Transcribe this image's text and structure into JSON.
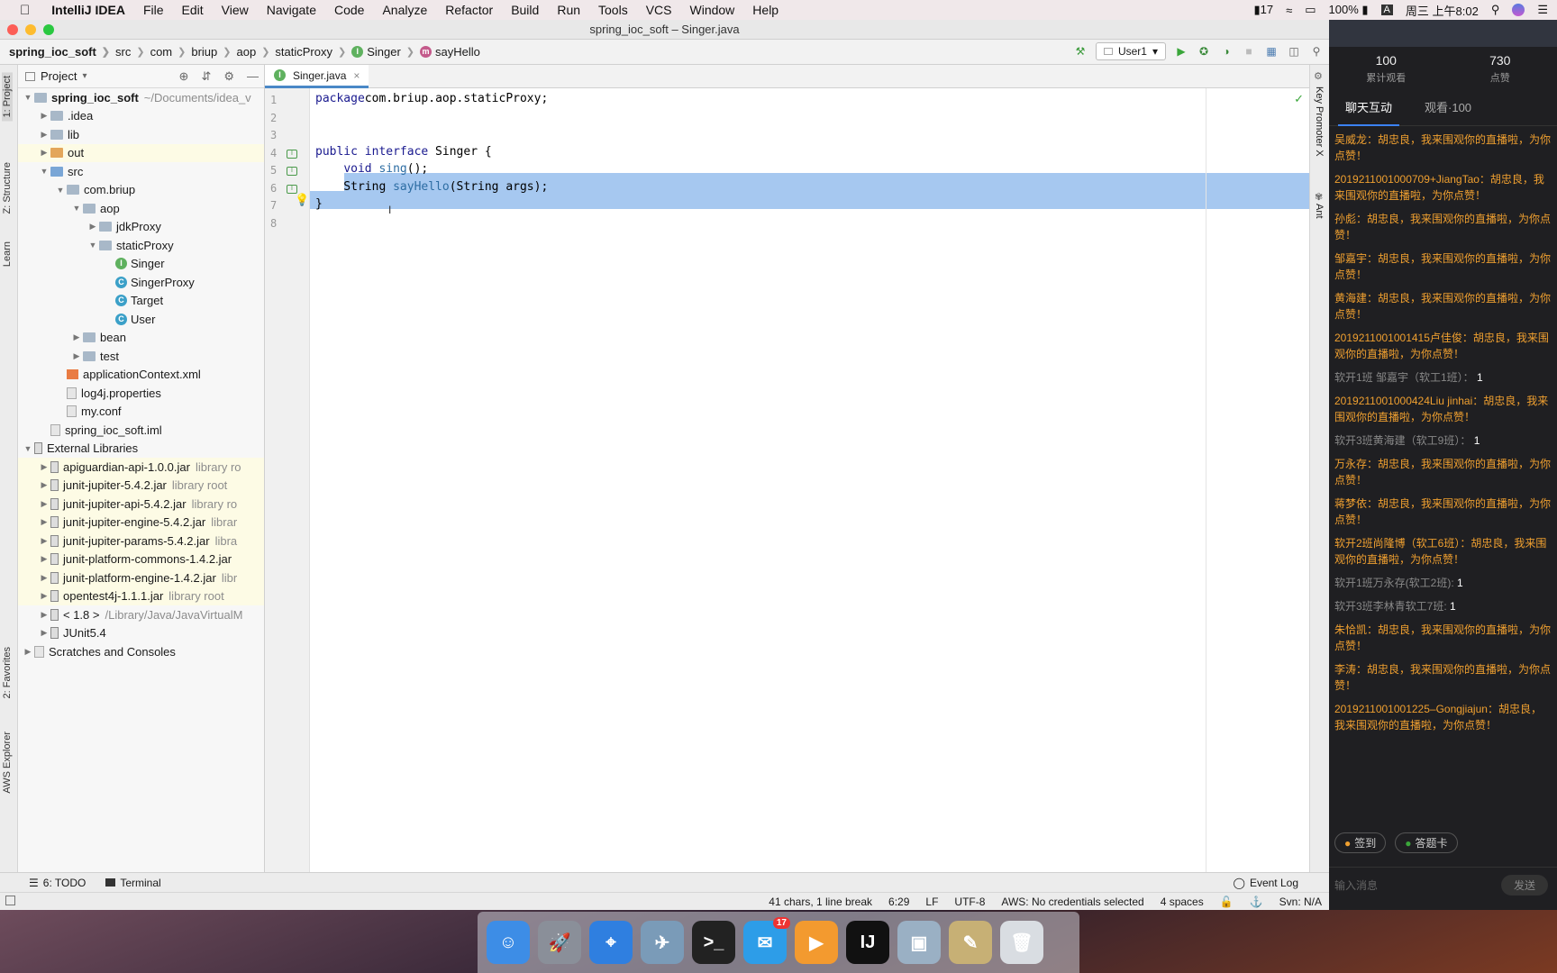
{
  "menubar": {
    "app_name": "IntelliJ IDEA",
    "items": [
      "File",
      "Edit",
      "View",
      "Navigate",
      "Code",
      "Analyze",
      "Refactor",
      "Build",
      "Run",
      "Tools",
      "VCS",
      "Window",
      "Help"
    ],
    "notif_count": "17",
    "battery": "100%",
    "clock": "周三 上午8:02",
    "input_method": "A"
  },
  "window": {
    "title": "spring_ioc_soft – Singer.java"
  },
  "breadcrumbs": [
    "spring_ioc_soft",
    "src",
    "com",
    "briup",
    "aop",
    "staticProxy",
    "Singer",
    "sayHello"
  ],
  "run_config": "User1",
  "project_panel": {
    "title": "Project",
    "tree": [
      {
        "label": "spring_ioc_soft",
        "extra": "~/Documents/idea_v",
        "indent": 0,
        "arrow": "▼",
        "icon": "folder",
        "bold": true
      },
      {
        "label": ".idea",
        "indent": 1,
        "arrow": "▶",
        "icon": "folder"
      },
      {
        "label": "lib",
        "indent": 1,
        "arrow": "▶",
        "icon": "folder"
      },
      {
        "label": "out",
        "indent": 1,
        "arrow": "▶",
        "icon": "folder-orange",
        "hl": true
      },
      {
        "label": "src",
        "indent": 1,
        "arrow": "▼",
        "icon": "folder-blue"
      },
      {
        "label": "com.briup",
        "indent": 2,
        "arrow": "▼",
        "icon": "folder"
      },
      {
        "label": "aop",
        "indent": 3,
        "arrow": "▼",
        "icon": "folder"
      },
      {
        "label": "jdkProxy",
        "indent": 4,
        "arrow": "▶",
        "icon": "folder"
      },
      {
        "label": "staticProxy",
        "indent": 4,
        "arrow": "▼",
        "icon": "folder"
      },
      {
        "label": "Singer",
        "indent": 5,
        "arrow": "",
        "icon": "I"
      },
      {
        "label": "SingerProxy",
        "indent": 5,
        "arrow": "",
        "icon": "C"
      },
      {
        "label": "Target",
        "indent": 5,
        "arrow": "",
        "icon": "C"
      },
      {
        "label": "User",
        "indent": 5,
        "arrow": "",
        "icon": "C"
      },
      {
        "label": "bean",
        "indent": 3,
        "arrow": "▶",
        "icon": "folder"
      },
      {
        "label": "test",
        "indent": 3,
        "arrow": "▶",
        "icon": "folder"
      },
      {
        "label": "applicationContext.xml",
        "indent": 2,
        "arrow": "",
        "icon": "xml"
      },
      {
        "label": "log4j.properties",
        "indent": 2,
        "arrow": "",
        "icon": "file"
      },
      {
        "label": "my.conf",
        "indent": 2,
        "arrow": "",
        "icon": "file"
      },
      {
        "label": "spring_ioc_soft.iml",
        "indent": 1,
        "arrow": "",
        "icon": "file"
      },
      {
        "label": "External Libraries",
        "indent": 0,
        "arrow": "▼",
        "icon": "jar"
      },
      {
        "label": "apiguardian-api-1.0.0.jar",
        "extra": "library ro",
        "indent": 1,
        "arrow": "▶",
        "icon": "jar",
        "hl": true
      },
      {
        "label": "junit-jupiter-5.4.2.jar",
        "extra": "library root",
        "indent": 1,
        "arrow": "▶",
        "icon": "jar",
        "hl": true
      },
      {
        "label": "junit-jupiter-api-5.4.2.jar",
        "extra": "library ro",
        "indent": 1,
        "arrow": "▶",
        "icon": "jar",
        "hl": true
      },
      {
        "label": "junit-jupiter-engine-5.4.2.jar",
        "extra": "librar",
        "indent": 1,
        "arrow": "▶",
        "icon": "jar",
        "hl": true
      },
      {
        "label": "junit-jupiter-params-5.4.2.jar",
        "extra": "libra",
        "indent": 1,
        "arrow": "▶",
        "icon": "jar",
        "hl": true
      },
      {
        "label": "junit-platform-commons-1.4.2.jar",
        "extra": "",
        "indent": 1,
        "arrow": "▶",
        "icon": "jar",
        "hl": true
      },
      {
        "label": "junit-platform-engine-1.4.2.jar",
        "extra": "libr",
        "indent": 1,
        "arrow": "▶",
        "icon": "jar",
        "hl": true
      },
      {
        "label": "opentest4j-1.1.1.jar",
        "extra": "library root",
        "indent": 1,
        "arrow": "▶",
        "icon": "jar",
        "hl": true
      },
      {
        "label": "< 1.8 >",
        "extra": "/Library/Java/JavaVirtualM",
        "indent": 1,
        "arrow": "▶",
        "icon": "jar"
      },
      {
        "label": "JUnit5.4",
        "indent": 1,
        "arrow": "▶",
        "icon": "jar"
      },
      {
        "label": "Scratches and Consoles",
        "indent": 0,
        "arrow": "▶",
        "icon": "file"
      }
    ]
  },
  "left_tabs": [
    "1: Project",
    "Z: Structure",
    "Learn",
    "2: Favorites",
    "AWS Explorer"
  ],
  "right_tabs": [
    "Key Promoter X",
    "Ant"
  ],
  "editor": {
    "tab_label": "Singer.java",
    "lines": [
      {
        "n": "1",
        "parts": [
          [
            "kw",
            "package"
          ],
          [
            "",
            "com.briup.aop.staticProxy;"
          ]
        ]
      },
      {
        "n": "2",
        "parts": []
      },
      {
        "n": "3",
        "parts": []
      },
      {
        "n": "4",
        "parts": [
          [
            "kw",
            "public interface"
          ],
          [
            "",
            " Singer {"
          ]
        ]
      },
      {
        "n": "5",
        "parts": [
          [
            "",
            "    "
          ],
          [
            "kw",
            "void"
          ],
          [
            "",
            " "
          ],
          [
            "fn",
            "sing"
          ],
          [
            "",
            "();"
          ]
        ]
      },
      {
        "n": "6",
        "parts": [
          [
            "",
            "    String "
          ],
          [
            "fn",
            "sayHello"
          ],
          [
            "",
            "(String args);"
          ]
        ]
      },
      {
        "n": "7",
        "parts": [
          [
            "",
            "}"
          ]
        ]
      },
      {
        "n": "8",
        "parts": []
      }
    ]
  },
  "bottom_tools": {
    "todo": "6: TODO",
    "terminal": "Terminal",
    "event_log": "Event Log"
  },
  "status": {
    "selection": "41 chars, 1 line break",
    "position": "6:29",
    "line_sep": "LF",
    "encoding": "UTF-8",
    "aws": "AWS: No credentials selected",
    "indent": "4 spaces",
    "svn": "Svn: N/A"
  },
  "chat": {
    "stats": [
      {
        "value": "100",
        "label": "累计观看"
      },
      {
        "value": "730",
        "label": "点赞"
      }
    ],
    "tabs": [
      "聊天互动",
      "观看·100"
    ],
    "messages": [
      {
        "t": "吴威龙：胡忠良，我来围观你的直播啦，为你点赞！"
      },
      {
        "t": "2019211001000709+JiangTao：胡忠良，我来围观你的直播啦，为你点赞！"
      },
      {
        "t": "孙彪：胡忠良，我来围观你的直播啦，为你点赞！"
      },
      {
        "t": "邹嘉宇：胡忠良，我来围观你的直播啦，为你点赞！"
      },
      {
        "t": "黄海建：胡忠良，我来围观你的直播啦，为你点赞！"
      },
      {
        "t": "2019211001001415卢佳俊：胡忠良，我来围观你的直播啦，为你点赞！"
      },
      {
        "t": "软开1班 邹嘉宇（软工1班）：",
        "v": "1",
        "sys": true
      },
      {
        "t": "2019211001000424Liu jinhai：胡忠良，我来围观你的直播啦，为你点赞！"
      },
      {
        "t": "软开3班黄海建（软工9班）：",
        "v": "1",
        "sys": true
      },
      {
        "t": "万永存：胡忠良，我来围观你的直播啦，为你点赞！"
      },
      {
        "t": "蒋梦依：胡忠良，我来围观你的直播啦，为你点赞！"
      },
      {
        "t": "软开2班尚隆博（软工6班）：胡忠良，我来围观你的直播啦，为你点赞！"
      },
      {
        "t": "软开1班万永存(软工2班):",
        "v": "1",
        "sys": true
      },
      {
        "t": "软开3班李林青软工7班:",
        "v": "1",
        "sys": true
      },
      {
        "t": "朱恰凯：胡忠良，我来围观你的直播啦，为你点赞！"
      },
      {
        "t": "李涛：胡忠良，我来围观你的直播啦，为你点赞！"
      },
      {
        "t": "2019211001001225–Gongjiajun：胡忠良，我来围观你的直播啦，为你点赞！"
      }
    ],
    "btn_signin": "签到",
    "btn_card": "答题卡",
    "input_placeholder": "输入消息",
    "send": "发送"
  },
  "dock": [
    {
      "name": "finder-icon",
      "color": "#3d8de6",
      "glyph": "☺"
    },
    {
      "name": "launchpad-icon",
      "color": "#8a8f99",
      "glyph": "🚀"
    },
    {
      "name": "safari-icon",
      "color": "#2f7fe0",
      "glyph": "⌖"
    },
    {
      "name": "preview-icon",
      "color": "#7a9bb8",
      "glyph": "✈"
    },
    {
      "name": "terminal-icon",
      "color": "#222222",
      "glyph": ">_"
    },
    {
      "name": "mail-icon",
      "color": "#2d9de8",
      "glyph": "✉",
      "badge": "17"
    },
    {
      "name": "video-app-icon",
      "color": "#f39a2f",
      "glyph": "▶"
    },
    {
      "name": "intellij-icon",
      "color": "#111111",
      "glyph": "IJ"
    },
    {
      "name": "photos-icon",
      "color": "#9ab0c4",
      "glyph": "▣"
    },
    {
      "name": "paintbrush-icon",
      "color": "#c7b075",
      "glyph": "✎"
    },
    {
      "name": "trash-icon",
      "color": "#d9dde2",
      "glyph": "🗑"
    }
  ]
}
